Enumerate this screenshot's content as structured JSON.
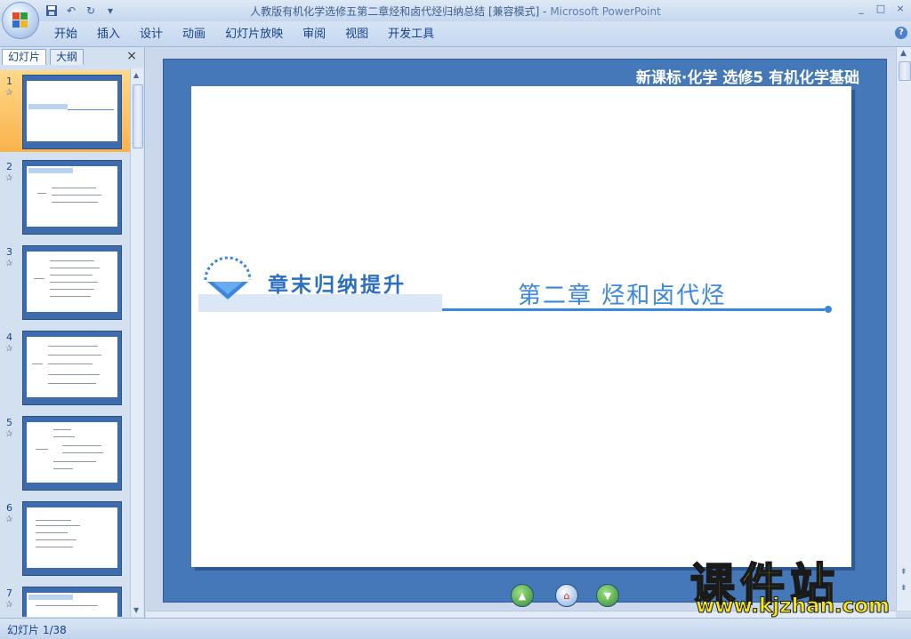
{
  "window": {
    "title": "人教版有机化学选修五第二章烃和卤代烃归纳总结 [兼容模式]",
    "app_name": "Microsoft PowerPoint",
    "controls": [
      "_",
      "□",
      "×"
    ]
  },
  "ribbon": {
    "tabs": [
      "开始",
      "插入",
      "设计",
      "动画",
      "幻灯片放映",
      "审阅",
      "视图",
      "开发工具"
    ]
  },
  "left_pane": {
    "tabs": [
      "幻灯片",
      "大纲"
    ],
    "close_symbol": "×",
    "selected_index": 0,
    "slides": [
      {
        "number": "1"
      },
      {
        "number": "2"
      },
      {
        "number": "3"
      },
      {
        "number": "4"
      },
      {
        "number": "5"
      },
      {
        "number": "6"
      },
      {
        "number": "7"
      }
    ]
  },
  "slide": {
    "header": "新课标·化学 选修5 有机化学基础",
    "heading_left": "章末归纳提升",
    "heading_right": "第二章 烃和卤代烃",
    "colors": {
      "frame": "#4478b8",
      "accent": "#3a87e0",
      "heading": "#2b6fc4"
    }
  },
  "watermark": {
    "cn": "课件站",
    "url": "www.kjzhan.com"
  },
  "status": {
    "slide_counter": "幻灯片 1/38"
  }
}
